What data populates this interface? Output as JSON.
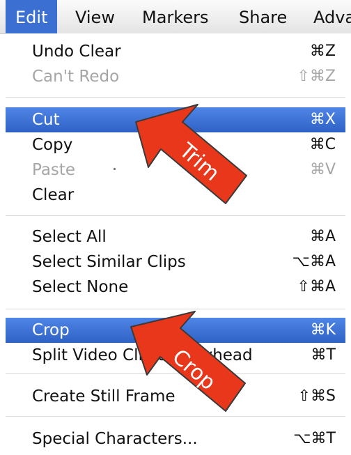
{
  "menubar": {
    "items": [
      "Edit",
      "View",
      "Markers",
      "Share",
      "Adva"
    ]
  },
  "menu": {
    "undo": {
      "label": "Undo Clear",
      "shortcut": "⌘Z"
    },
    "redo": {
      "label": "Can't Redo",
      "shortcut": "⇧⌘Z"
    },
    "cut": {
      "label": "Cut",
      "shortcut": "⌘X"
    },
    "copy": {
      "label": "Copy",
      "shortcut": "⌘C"
    },
    "paste": {
      "label": "Paste",
      "shortcut": "⌘V"
    },
    "clear": {
      "label": "Clear",
      "shortcut": ""
    },
    "select_all": {
      "label": "Select All",
      "shortcut": "⌘A"
    },
    "select_similar": {
      "label": "Select Similar Clips",
      "shortcut": "⌥⌘A"
    },
    "select_none": {
      "label": "Select None",
      "shortcut": "⇧⌘A"
    },
    "crop": {
      "label": "Crop",
      "shortcut": "⌘K"
    },
    "split": {
      "label": "Split Video Clip at Playhead",
      "shortcut": "⌘T"
    },
    "still_frame": {
      "label": "Create Still Frame",
      "shortcut": "⇧⌘S"
    },
    "special_chars": {
      "label": "Special Characters...",
      "shortcut": "⌥⌘T"
    }
  },
  "annotations": {
    "trim": "Trim",
    "crop": "Crop",
    "arrow_color": "#e8371b"
  }
}
